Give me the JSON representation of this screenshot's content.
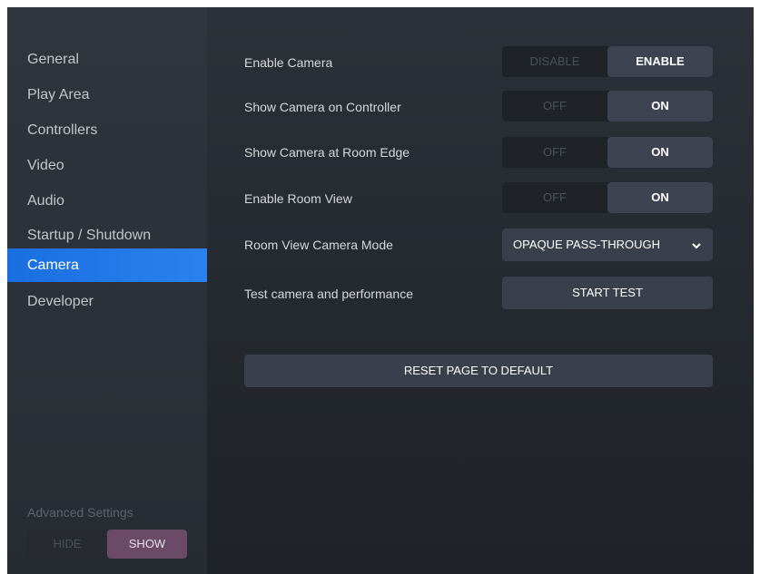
{
  "sidebar": {
    "items": [
      {
        "label": "General"
      },
      {
        "label": "Play Area"
      },
      {
        "label": "Controllers"
      },
      {
        "label": "Video"
      },
      {
        "label": "Audio"
      },
      {
        "label": "Startup / Shutdown"
      },
      {
        "label": "Camera",
        "active": true
      },
      {
        "label": "Developer"
      }
    ],
    "advanced": {
      "label": "Advanced Settings",
      "hide": "HIDE",
      "show": "SHOW",
      "selected": "SHOW"
    }
  },
  "settings": {
    "enable_camera": {
      "label": "Enable Camera",
      "off": "DISABLE",
      "on": "ENABLE",
      "value": "ENABLE"
    },
    "show_on_controller": {
      "label": "Show Camera on Controller",
      "off": "OFF",
      "on": "ON",
      "value": "ON"
    },
    "show_at_room_edge": {
      "label": "Show Camera at Room Edge",
      "off": "OFF",
      "on": "ON",
      "value": "ON"
    },
    "enable_room_view": {
      "label": "Enable Room View",
      "off": "OFF",
      "on": "ON",
      "value": "ON"
    },
    "room_view_mode": {
      "label": "Room View Camera Mode",
      "value": "OPAQUE PASS-THROUGH"
    },
    "test_camera": {
      "label": "Test camera and performance",
      "button": "START TEST"
    }
  },
  "reset_button": "RESET PAGE TO DEFAULT",
  "colors": {
    "accent": "#2a82f0",
    "active_toggle": "#3d4350",
    "show_toggle": "#6a4a66"
  }
}
